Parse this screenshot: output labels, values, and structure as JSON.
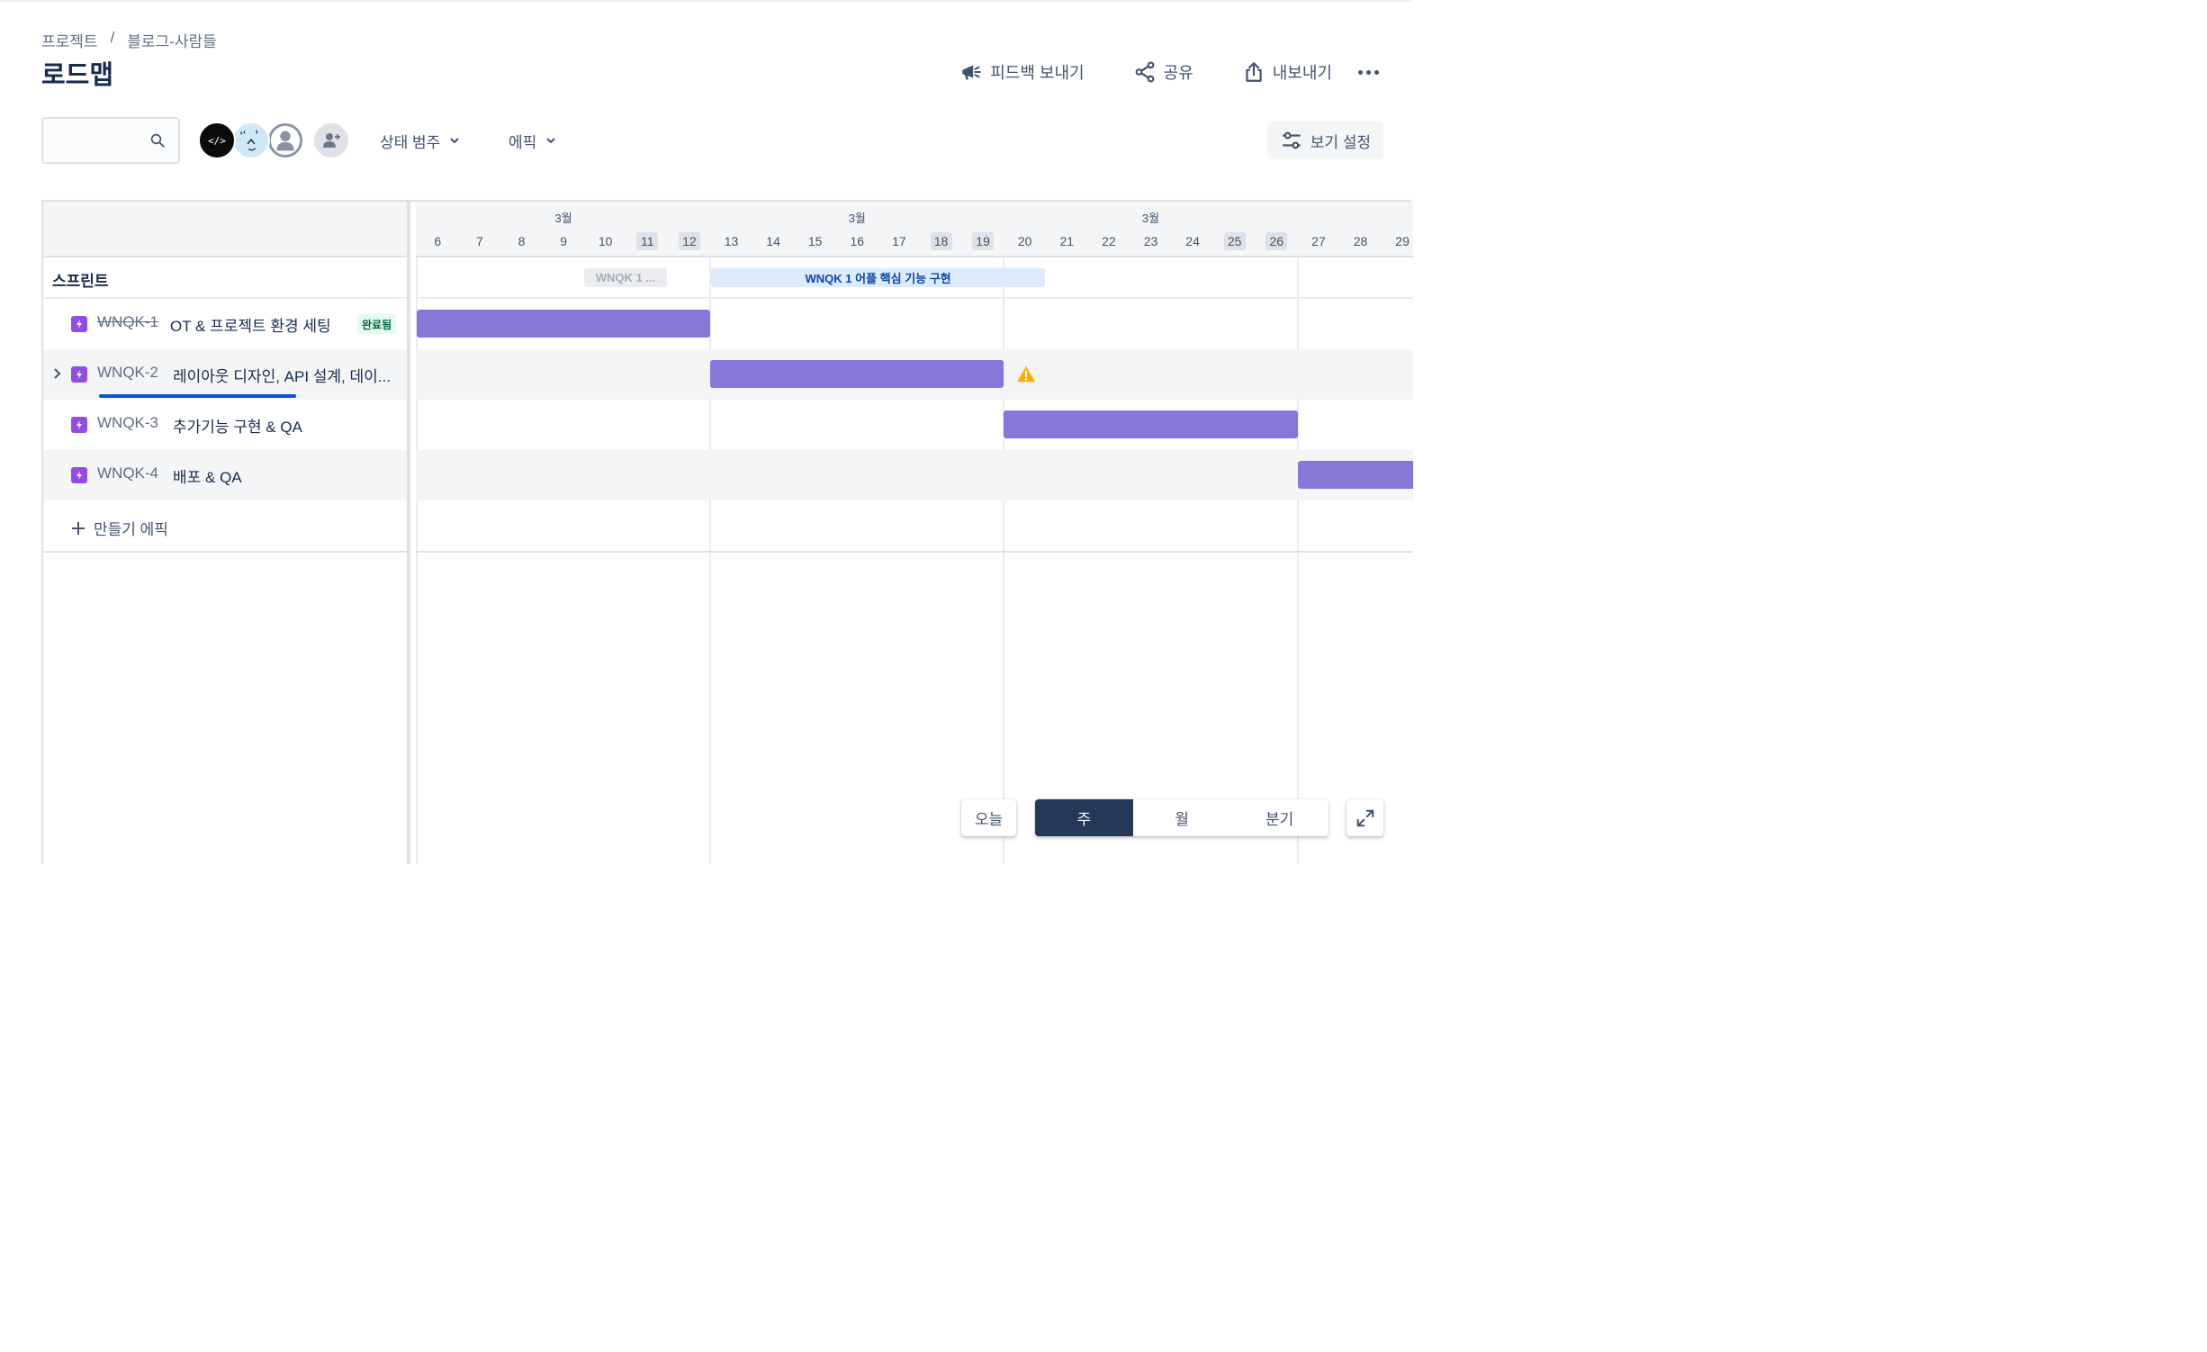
{
  "breadcrumb": {
    "items": [
      "프로젝트",
      "블로그-사람들"
    ],
    "separator": "/"
  },
  "page": {
    "title": "로드맵"
  },
  "header_actions": {
    "feedback_label": "피드백 보내기",
    "share_label": "공유",
    "export_label": "내보내기",
    "more_icon": "more-horizontal-icon"
  },
  "toolbar": {
    "search": {
      "placeholder": "",
      "value": "",
      "icon": "search-icon"
    },
    "avatars": [
      {
        "label": "</>",
        "kind": "code-logo"
      },
      {
        "label": "",
        "kind": "character-face"
      },
      {
        "label": "",
        "kind": "default-person"
      }
    ],
    "add_people_icon": "add-person-icon",
    "filters": {
      "status_category_label": "상태 범주",
      "epic_label": "에픽"
    },
    "view_settings_label": "보기 설정"
  },
  "roadmap": {
    "sprint_row_label": "스프린트",
    "months": [
      "3월",
      "3월",
      "3월"
    ],
    "days": [
      {
        "label": "6",
        "weekend": false
      },
      {
        "label": "7",
        "weekend": false
      },
      {
        "label": "8",
        "weekend": false
      },
      {
        "label": "9",
        "weekend": false
      },
      {
        "label": "10",
        "weekend": false
      },
      {
        "label": "11",
        "weekend": true
      },
      {
        "label": "12",
        "weekend": true
      },
      {
        "label": "13",
        "weekend": false
      },
      {
        "label": "14",
        "weekend": false
      },
      {
        "label": "15",
        "weekend": false
      },
      {
        "label": "16",
        "weekend": false
      },
      {
        "label": "17",
        "weekend": false
      },
      {
        "label": "18",
        "weekend": true
      },
      {
        "label": "19",
        "weekend": true
      },
      {
        "label": "20",
        "weekend": false
      },
      {
        "label": "21",
        "weekend": false
      },
      {
        "label": "22",
        "weekend": false
      },
      {
        "label": "23",
        "weekend": false
      },
      {
        "label": "24",
        "weekend": false
      },
      {
        "label": "25",
        "weekend": true
      },
      {
        "label": "26",
        "weekend": true
      },
      {
        "label": "27",
        "weekend": false
      },
      {
        "label": "28",
        "weekend": false
      },
      {
        "label": "29",
        "weekend": false
      }
    ],
    "sprints": [
      {
        "label": "WNQK 1 ...",
        "state": "past"
      },
      {
        "label": "WNQK 1 어플 핵심 기능 구현",
        "state": "active"
      }
    ],
    "epics": [
      {
        "key": "WNQK-1",
        "title": "OT & 프로젝트 환경 세팅",
        "done": true,
        "status_badge": "완료됨",
        "start": "3/6",
        "end": "3/12",
        "expandable": false,
        "warning": false
      },
      {
        "key": "WNQK-2",
        "title": "레이아웃 디자인, API 설계, 데이...",
        "done": false,
        "status_badge": "",
        "start": "3/13",
        "end": "3/19",
        "expandable": true,
        "warning": true
      },
      {
        "key": "WNQK-3",
        "title": "추가기능 구현 & QA",
        "done": false,
        "status_badge": "",
        "start": "3/20",
        "end": "3/26",
        "expandable": false,
        "warning": false
      },
      {
        "key": "WNQK-4",
        "title": "배포 & QA",
        "done": false,
        "status_badge": "",
        "start": "3/27",
        "end": "",
        "expandable": false,
        "warning": false
      }
    ],
    "create_epic_label": "만들기 에픽"
  },
  "bottom_controls": {
    "today_label": "오늘",
    "scale_options": [
      "주",
      "월",
      "분기"
    ],
    "selected_scale": "주",
    "fullscreen_icon": "expand-icon"
  },
  "colors": {
    "epic_bar": "#8777d9",
    "epic_icon": "#904ee2",
    "active_sprint_bg": "#deebff",
    "active_sprint_text": "#0747a6",
    "done_badge_bg": "#e3fcef",
    "done_badge_text": "#006644",
    "selected_scale_bg": "#253858",
    "warning": "#ffab00"
  }
}
